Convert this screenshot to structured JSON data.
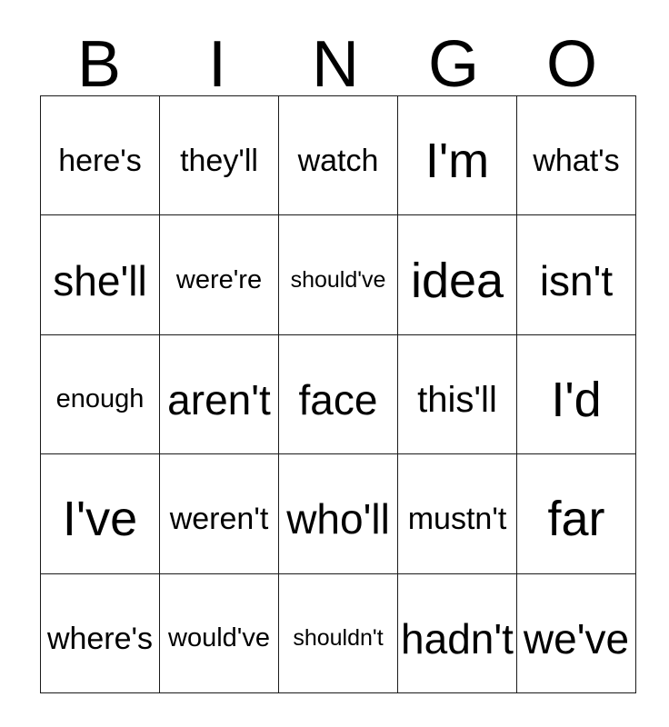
{
  "card": {
    "header_letters": [
      "B",
      "I",
      "N",
      "G",
      "O"
    ],
    "rows": [
      [
        {
          "text": "here's",
          "size": "md"
        },
        {
          "text": "they'll",
          "size": "md"
        },
        {
          "text": "watch",
          "size": "md"
        },
        {
          "text": "I'm",
          "size": "xxl"
        },
        {
          "text": "what's",
          "size": "md"
        }
      ],
      [
        {
          "text": "she'll",
          "size": "xl"
        },
        {
          "text": "were're",
          "size": "sm"
        },
        {
          "text": "should've",
          "size": "xs"
        },
        {
          "text": "idea",
          "size": "xxl"
        },
        {
          "text": "isn't",
          "size": "xl"
        }
      ],
      [
        {
          "text": "enough",
          "size": "sm"
        },
        {
          "text": "aren't",
          "size": "xl"
        },
        {
          "text": "face",
          "size": "xl"
        },
        {
          "text": "this'll",
          "size": "lg"
        },
        {
          "text": "I'd",
          "size": "xxl"
        }
      ],
      [
        {
          "text": "I've",
          "size": "xxl"
        },
        {
          "text": "weren't",
          "size": "md"
        },
        {
          "text": "who'll",
          "size": "xl"
        },
        {
          "text": "mustn't",
          "size": "md"
        },
        {
          "text": "far",
          "size": "xxl"
        }
      ],
      [
        {
          "text": "where's",
          "size": "md"
        },
        {
          "text": "would've",
          "size": "sm"
        },
        {
          "text": "shouldn't",
          "size": "xs"
        },
        {
          "text": "hadn't",
          "size": "xl"
        },
        {
          "text": "we've",
          "size": "xl"
        }
      ]
    ]
  }
}
